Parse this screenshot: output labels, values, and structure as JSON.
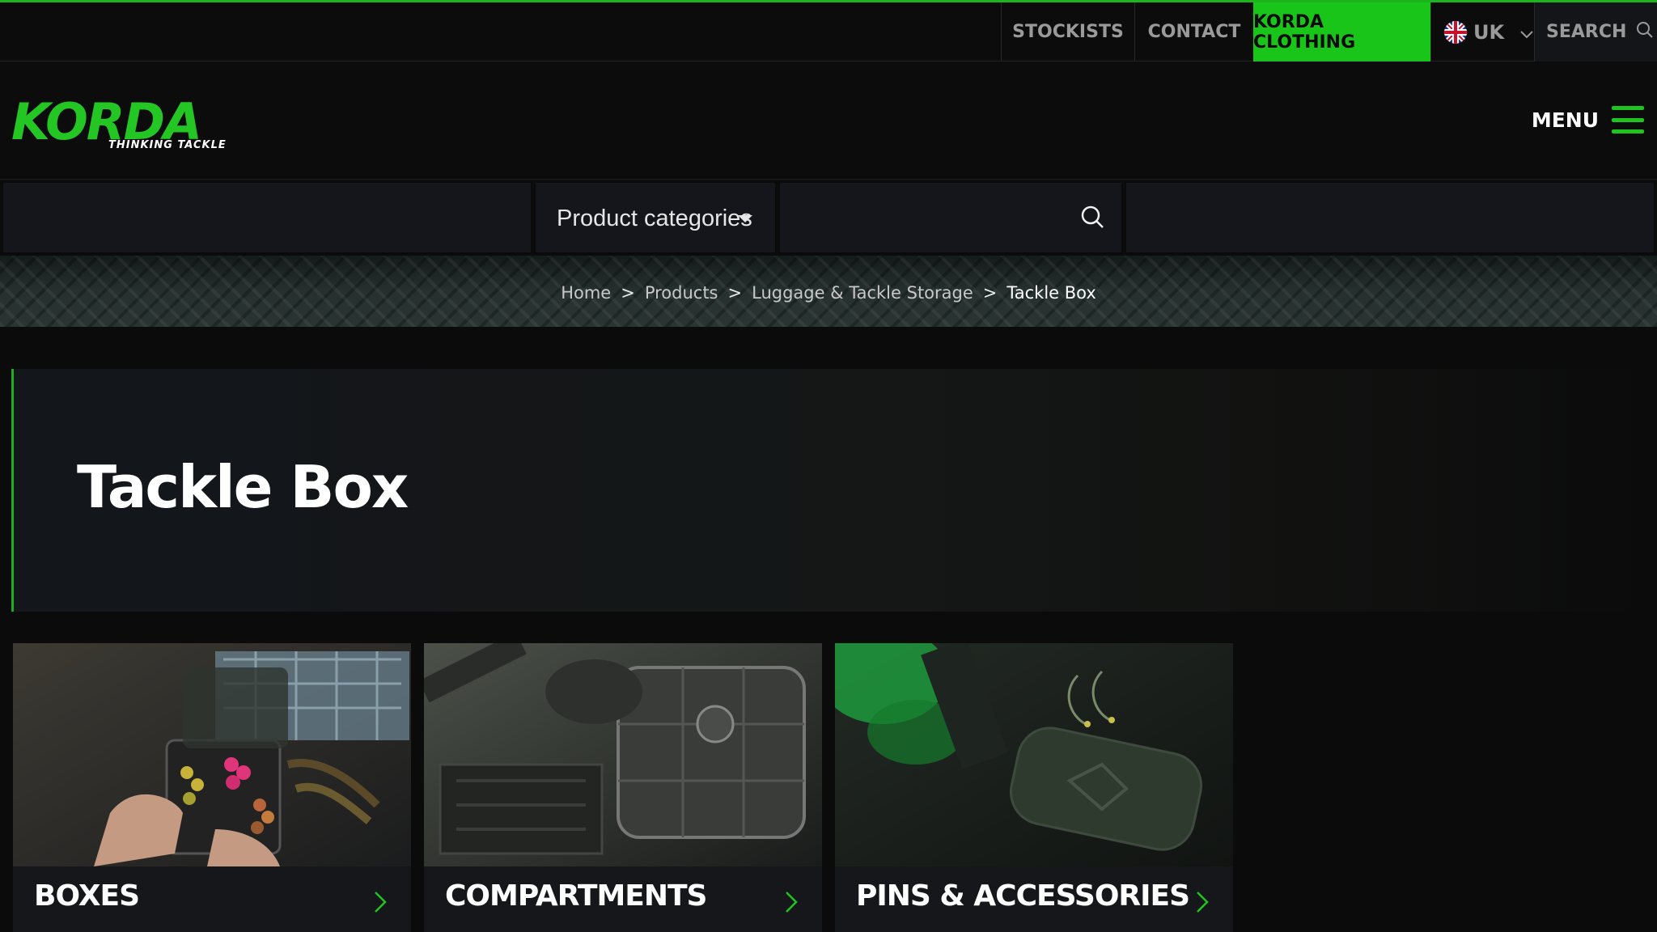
{
  "topnav": {
    "stockists": "STOCKISTS",
    "contact": "CONTACT",
    "clothing": "KORDA CLOTHING",
    "region": "UK",
    "search": "SEARCH"
  },
  "brand": {
    "logo_text": "KORDA",
    "tagline": "THINKING TACKLE",
    "accent_color": "#1fc41f"
  },
  "header": {
    "menu_label": "MENU"
  },
  "filters": {
    "categories_label": "Product categories",
    "search_placeholder": ""
  },
  "breadcrumb": {
    "items": [
      "Home",
      "Products",
      "Luggage & Tackle Storage"
    ],
    "separator": ">",
    "current": "Tackle Box"
  },
  "hero": {
    "title": "Tackle Box"
  },
  "categories": [
    {
      "label": "BOXES",
      "icon": "chevron-right-icon"
    },
    {
      "label": "COMPARTMENTS",
      "icon": "chevron-right-icon"
    },
    {
      "label": "PINS & ACCESSORIES",
      "icon": "chevron-right-icon"
    }
  ]
}
